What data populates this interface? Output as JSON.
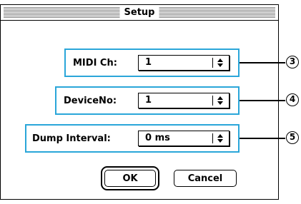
{
  "window": {
    "title": "Setup"
  },
  "settings": {
    "midi_ch": {
      "label": "MIDI Ch:",
      "value": "1",
      "callout": "3"
    },
    "device_no": {
      "label": "DeviceNo:",
      "value": "1",
      "callout": "4"
    },
    "dump_interval": {
      "label": "Dump Interval:",
      "value": "0 ms",
      "callout": "5"
    }
  },
  "buttons": {
    "ok": "OK",
    "cancel": "Cancel"
  },
  "colors": {
    "highlight_border": "#2aa6d9"
  }
}
